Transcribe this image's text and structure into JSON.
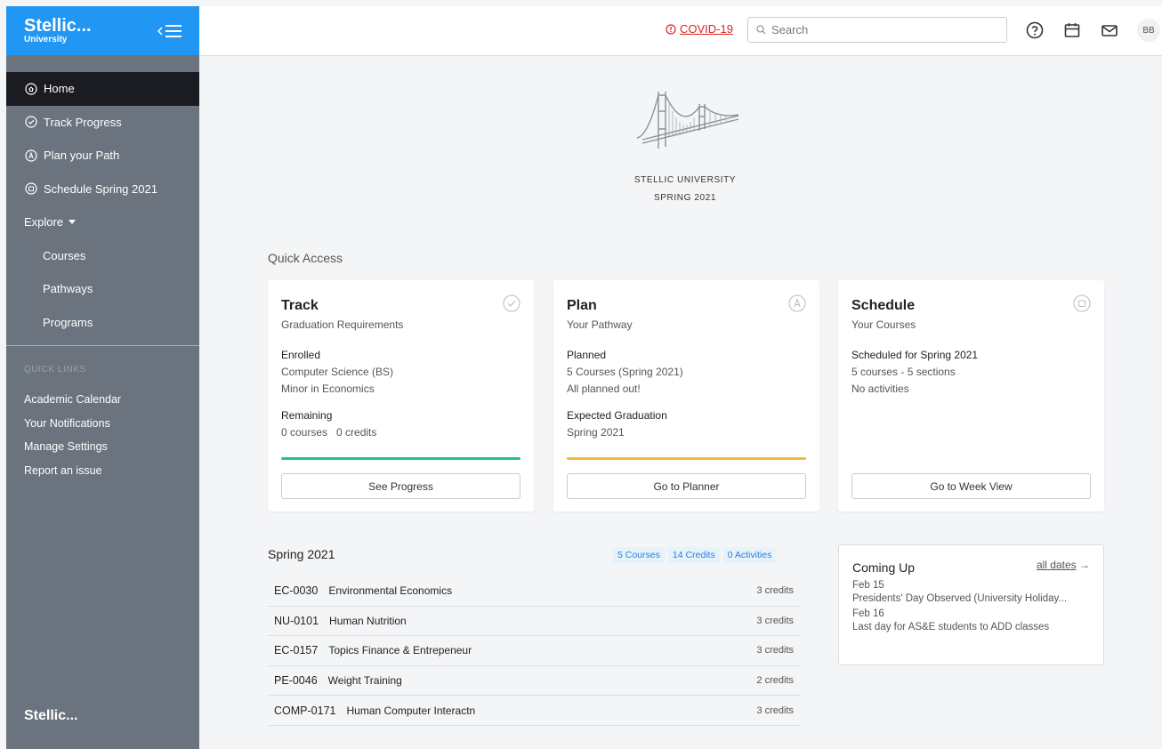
{
  "sidebar": {
    "brand_name": "Stellic...",
    "brand_sub": "University",
    "nav": [
      {
        "label": "Home"
      },
      {
        "label": "Track Progress"
      },
      {
        "label": "Plan your Path"
      },
      {
        "label": "Schedule Spring 2021"
      },
      {
        "label": "Explore"
      },
      {
        "label": "Courses"
      },
      {
        "label": "Pathways"
      },
      {
        "label": "Programs"
      }
    ],
    "quick_links_title": "QUICK LINKS",
    "quick_links": [
      {
        "label": "Academic Calendar"
      },
      {
        "label": "Your Notifications"
      },
      {
        "label": "Manage Settings"
      },
      {
        "label": "Report an issue"
      }
    ],
    "footer": "Stellic..."
  },
  "topbar": {
    "covid_label": "COVID-19",
    "search_placeholder": "Search",
    "avatar_initials": "BB"
  },
  "hero": {
    "university": "STELLIC UNIVERSITY",
    "term": "SPRING 2021"
  },
  "quick_access": {
    "title": "Quick Access",
    "cards": [
      {
        "title": "Track",
        "subtitle": "Graduation Requirements",
        "label1": "Enrolled",
        "val1a": "Computer Science (BS)",
        "val1b": "Minor in Economics",
        "label2": "Remaining",
        "val2": "0 courses   0 credits",
        "progress": 1.0,
        "bar_color": "#20c38b",
        "button": "See Progress"
      },
      {
        "title": "Plan",
        "subtitle": "Your Pathway",
        "label1": "Planned",
        "val1a": "5 Courses (Spring 2021)",
        "val1b": "All planned out!",
        "label2": "Expected Graduation",
        "val2": "Spring 2021",
        "progress": 1.0,
        "bar_color": "#f2b92e",
        "button": "Go to Planner"
      },
      {
        "title": "Schedule",
        "subtitle": "Your Courses",
        "label1": "Scheduled for Spring 2021",
        "val1a": "5 courses - 5 sections",
        "val1b": "No activities",
        "button": "Go to Week View"
      }
    ]
  },
  "semester": {
    "title": "Spring 2021",
    "tags": [
      "5 Courses",
      "14 Credits",
      "0 Activities"
    ],
    "courses": [
      {
        "code": "EC-0030",
        "name": "Environmental Economics",
        "credits": "3 credits"
      },
      {
        "code": "NU-0101",
        "name": "Human Nutrition",
        "credits": "3 credits"
      },
      {
        "code": "EC-0157",
        "name": "Topics Finance & Entrepeneur",
        "credits": "3 credits"
      },
      {
        "code": "PE-0046",
        "name": "Weight Training",
        "credits": "2 credits"
      },
      {
        "code": "COMP-0171",
        "name": "Human Computer Interactn",
        "credits": "3 credits"
      }
    ]
  },
  "upcoming": {
    "title": "Coming Up",
    "all_dates": "all dates",
    "events": [
      {
        "date": "Feb 15",
        "text": "Presidents' Day Observed (University Holiday..."
      },
      {
        "date": "Feb 16",
        "text": "Last day for AS&E students to ADD classes"
      }
    ]
  }
}
